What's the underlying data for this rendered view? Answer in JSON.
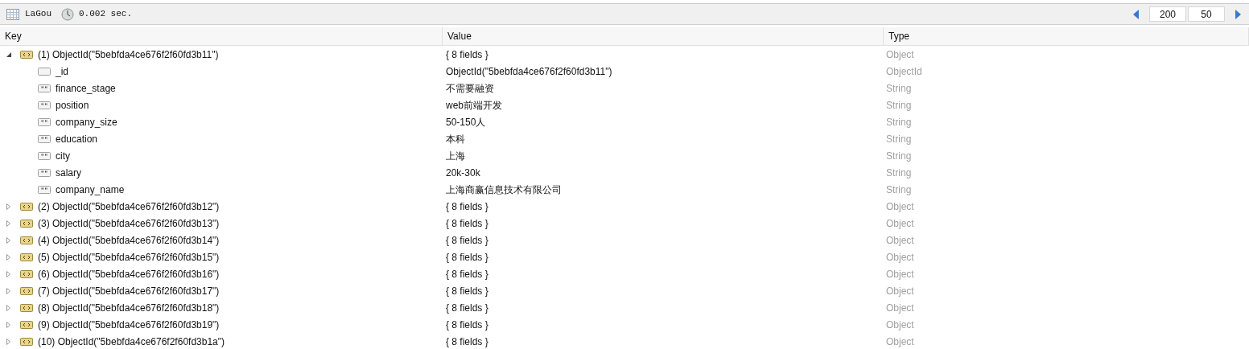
{
  "toolbar": {
    "collection": "LaGou",
    "time": "0.002 sec.",
    "skip": "200",
    "limit": "50"
  },
  "table": {
    "columns": [
      "Key",
      "Value",
      "Type"
    ],
    "rows": [
      {
        "kind": "document",
        "key": "(1) ObjectId(\"5bebfda4ce676f2f60fd3b11\")",
        "value": "{ 8 fields }",
        "type": "Object",
        "expanded": true,
        "children": [
          {
            "kind": "objectid",
            "key": "_id",
            "value": "ObjectId(\"5bebfda4ce676f2f60fd3b11\")",
            "type": "ObjectId"
          },
          {
            "kind": "string",
            "key": "finance_stage",
            "value": "不需要融资",
            "type": "String"
          },
          {
            "kind": "string",
            "key": "position",
            "value": "web前端开发",
            "type": "String"
          },
          {
            "kind": "string",
            "key": "company_size",
            "value": "50-150人",
            "type": "String"
          },
          {
            "kind": "string",
            "key": "education",
            "value": "本科",
            "type": "String"
          },
          {
            "kind": "string",
            "key": "city",
            "value": "上海",
            "type": "String"
          },
          {
            "kind": "string",
            "key": "salary",
            "value": "20k-30k",
            "type": "String"
          },
          {
            "kind": "string",
            "key": "company_name",
            "value": "上海商赢信息技术有限公司",
            "type": "String"
          }
        ]
      },
      {
        "kind": "document",
        "key": "(2) ObjectId(\"5bebfda4ce676f2f60fd3b12\")",
        "value": "{ 8 fields }",
        "type": "Object",
        "expanded": false
      },
      {
        "kind": "document",
        "key": "(3) ObjectId(\"5bebfda4ce676f2f60fd3b13\")",
        "value": "{ 8 fields }",
        "type": "Object",
        "expanded": false
      },
      {
        "kind": "document",
        "key": "(4) ObjectId(\"5bebfda4ce676f2f60fd3b14\")",
        "value": "{ 8 fields }",
        "type": "Object",
        "expanded": false
      },
      {
        "kind": "document",
        "key": "(5) ObjectId(\"5bebfda4ce676f2f60fd3b15\")",
        "value": "{ 8 fields }",
        "type": "Object",
        "expanded": false
      },
      {
        "kind": "document",
        "key": "(6) ObjectId(\"5bebfda4ce676f2f60fd3b16\")",
        "value": "{ 8 fields }",
        "type": "Object",
        "expanded": false
      },
      {
        "kind": "document",
        "key": "(7) ObjectId(\"5bebfda4ce676f2f60fd3b17\")",
        "value": "{ 8 fields }",
        "type": "Object",
        "expanded": false
      },
      {
        "kind": "document",
        "key": "(8) ObjectId(\"5bebfda4ce676f2f60fd3b18\")",
        "value": "{ 8 fields }",
        "type": "Object",
        "expanded": false
      },
      {
        "kind": "document",
        "key": "(9) ObjectId(\"5bebfda4ce676f2f60fd3b19\")",
        "value": "{ 8 fields }",
        "type": "Object",
        "expanded": false
      },
      {
        "kind": "document",
        "key": "(10) ObjectId(\"5bebfda4ce676f2f60fd3b1a\")",
        "value": "{ 8 fields }",
        "type": "Object",
        "expanded": false
      }
    ]
  }
}
